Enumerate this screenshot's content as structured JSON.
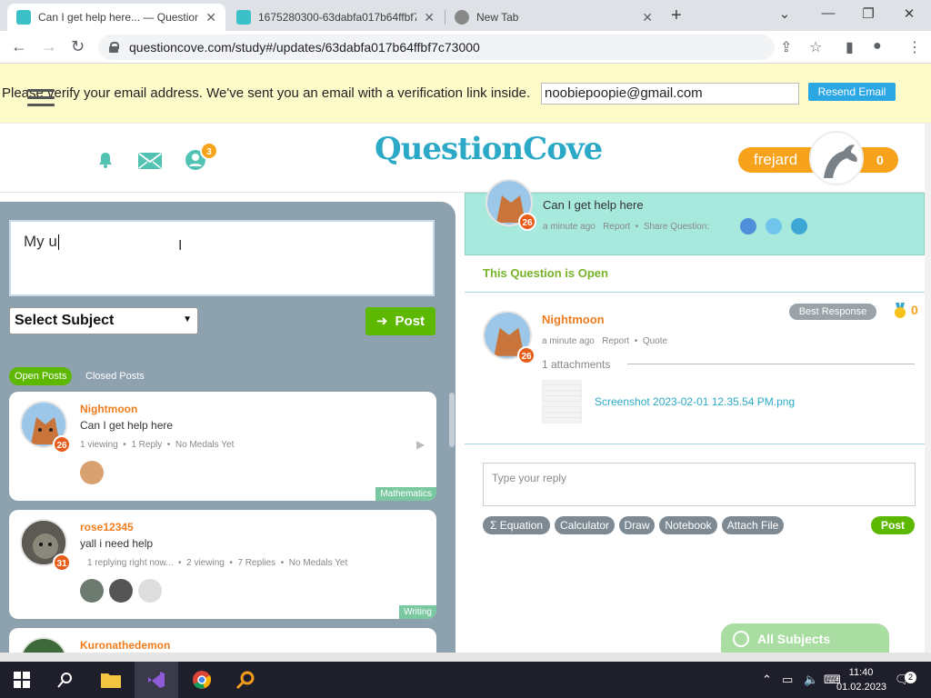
{
  "browser": {
    "tabs": [
      {
        "title": "Can I get help here... — Question",
        "active": true
      },
      {
        "title": "1675280300-63dabfa017b64ffbf7",
        "active": false
      },
      {
        "title": "New Tab",
        "active": false
      }
    ],
    "url": "questioncove.com/study#/updates/63dabfa017b64ffbf7c73000"
  },
  "banner": {
    "message": "Please verify your email address. We've sent you an email with a verification link inside.",
    "email": "noobiepoopie@gmail.com",
    "resend_label": "Resend Email"
  },
  "header": {
    "logo": "QuestionCove",
    "notifications_badge": "3",
    "username": "frejard",
    "score": "0"
  },
  "compose": {
    "text": "My u",
    "subject_select": "Select Subject",
    "post_label": "Post"
  },
  "filters": {
    "open": "Open Posts",
    "closed": "Closed Posts"
  },
  "posts": [
    {
      "author": "Nightmoon",
      "text": "Can I get help here",
      "level": "26",
      "meta": [
        "1 viewing",
        "1 Reply",
        "No Medals Yet"
      ],
      "subject": "Mathematics"
    },
    {
      "author": "rose12345",
      "text": "yall i need help",
      "level": "31",
      "meta": [
        "1 replying right now...",
        "2 viewing",
        "7 Replies",
        "No Medals Yet"
      ],
      "subject": "Writing"
    },
    {
      "author": "Kuronathedemon",
      "text": "",
      "level": "",
      "meta": [],
      "subject": ""
    }
  ],
  "question": {
    "text": "Can I get help here",
    "level": "26",
    "time": "a minute ago",
    "report": "Report",
    "share": "Share Question:",
    "status": "This Question is Open"
  },
  "reply": {
    "author": "Nightmoon",
    "level": "26",
    "time": "a minute ago",
    "report": "Report",
    "quote": "Quote",
    "best_response": "Best Response",
    "medals": "0",
    "attachments": "1 attachments",
    "attachment_name": "Screenshot 2023-02-01 12.35.54 PM.png"
  },
  "reply_box": {
    "placeholder": "Type your reply",
    "tools": [
      "Σ Equation",
      "Calculator",
      "Draw",
      "Notebook",
      "Attach File"
    ],
    "post_label": "Post"
  },
  "all_subjects": "All Subjects",
  "taskbar": {
    "time": "11:40",
    "date": "01.02.2023",
    "notifications": "2"
  },
  "colors": {
    "brand_teal": "#2ba9c6",
    "orange": "#f7a21b",
    "green": "#5cb800",
    "panel_gray": "#8ea1af"
  }
}
